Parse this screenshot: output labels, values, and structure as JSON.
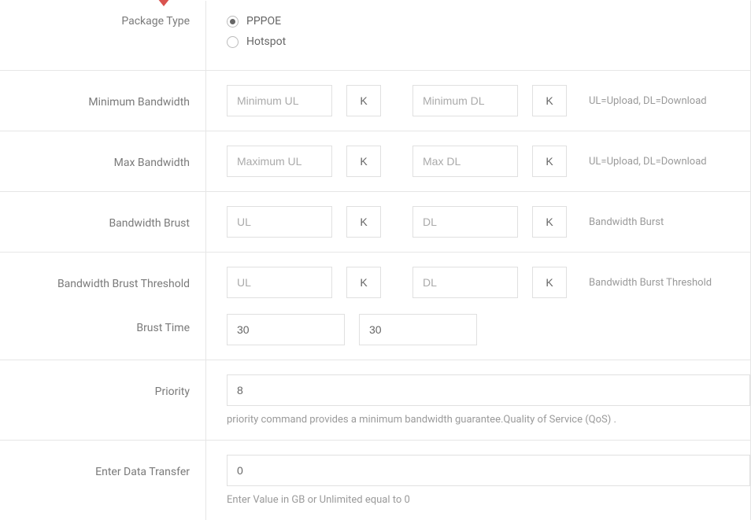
{
  "packageType": {
    "label": "Package Type",
    "options": [
      {
        "label": "PPPOE",
        "checked": true
      },
      {
        "label": "Hotspot",
        "checked": false
      }
    ]
  },
  "minBandwidth": {
    "label": "Minimum Bandwidth",
    "ulPlaceholder": "Minimum UL",
    "ulUnit": "K",
    "dlPlaceholder": "Minimum DL",
    "dlUnit": "K",
    "hint": "UL=Upload, DL=Download"
  },
  "maxBandwidth": {
    "label": "Max Bandwidth",
    "ulPlaceholder": "Maximum UL",
    "ulUnit": "K",
    "dlPlaceholder": "Max DL",
    "dlUnit": "K",
    "hint": "UL=Upload, DL=Download"
  },
  "brust": {
    "label": "Bandwidth Brust",
    "ulPlaceholder": "UL",
    "ulUnit": "K",
    "dlPlaceholder": "DL",
    "dlUnit": "K",
    "hint": "Bandwidth Burst"
  },
  "brustThreshold": {
    "label": "Bandwidth Brust Threshold",
    "ulPlaceholder": "UL",
    "ulUnit": "K",
    "dlPlaceholder": "DL",
    "dlUnit": "K",
    "hint": "Bandwidth Burst Threshold"
  },
  "brustTime": {
    "label": "Brust Time",
    "value1": "30",
    "value2": "30"
  },
  "priority": {
    "label": "Priority",
    "value": "8",
    "hint": "priority command provides a minimum bandwidth guarantee.Quality of Service (QoS) ."
  },
  "dataTransfer": {
    "label": "Enter Data Transfer",
    "value": "0",
    "hint": "Enter Value in GB or Unlimited equal to 0"
  }
}
